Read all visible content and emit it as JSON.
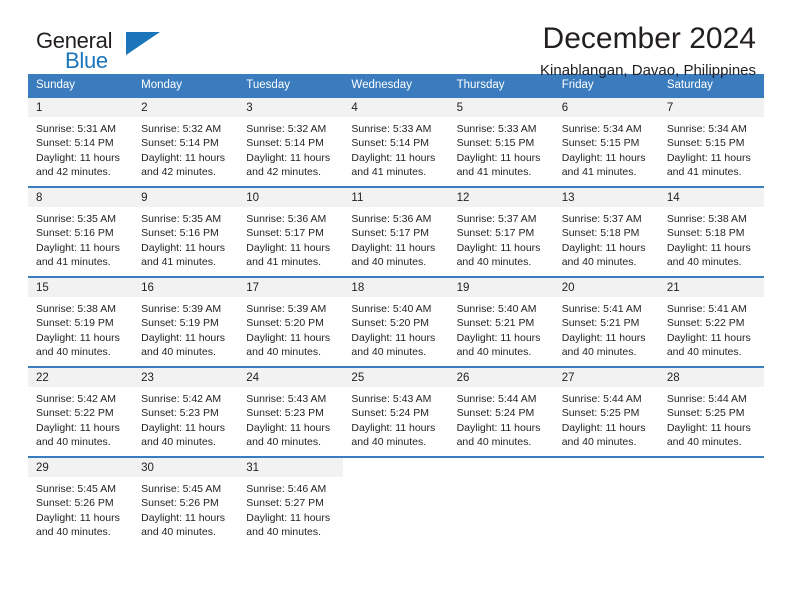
{
  "brand": {
    "name_part1": "General",
    "name_part2": "Blue",
    "triangle_color": "#1b75bb",
    "blue_color": "#1b75bb"
  },
  "header": {
    "title": "December 2024",
    "subtitle": "Kinablangan, Davao, Philippines"
  },
  "theme": {
    "header_bg": "#3a7cbe",
    "daynum_bg": "#f2f2f2",
    "text": "#231f20"
  },
  "weekday_headers": [
    "Sunday",
    "Monday",
    "Tuesday",
    "Wednesday",
    "Thursday",
    "Friday",
    "Saturday"
  ],
  "weeks": [
    [
      {
        "day": "1",
        "sunrise": "Sunrise: 5:31 AM",
        "sunset": "Sunset: 5:14 PM",
        "daylight1": "Daylight: 11 hours",
        "daylight2": "and 42 minutes."
      },
      {
        "day": "2",
        "sunrise": "Sunrise: 5:32 AM",
        "sunset": "Sunset: 5:14 PM",
        "daylight1": "Daylight: 11 hours",
        "daylight2": "and 42 minutes."
      },
      {
        "day": "3",
        "sunrise": "Sunrise: 5:32 AM",
        "sunset": "Sunset: 5:14 PM",
        "daylight1": "Daylight: 11 hours",
        "daylight2": "and 42 minutes."
      },
      {
        "day": "4",
        "sunrise": "Sunrise: 5:33 AM",
        "sunset": "Sunset: 5:14 PM",
        "daylight1": "Daylight: 11 hours",
        "daylight2": "and 41 minutes."
      },
      {
        "day": "5",
        "sunrise": "Sunrise: 5:33 AM",
        "sunset": "Sunset: 5:15 PM",
        "daylight1": "Daylight: 11 hours",
        "daylight2": "and 41 minutes."
      },
      {
        "day": "6",
        "sunrise": "Sunrise: 5:34 AM",
        "sunset": "Sunset: 5:15 PM",
        "daylight1": "Daylight: 11 hours",
        "daylight2": "and 41 minutes."
      },
      {
        "day": "7",
        "sunrise": "Sunrise: 5:34 AM",
        "sunset": "Sunset: 5:15 PM",
        "daylight1": "Daylight: 11 hours",
        "daylight2": "and 41 minutes."
      }
    ],
    [
      {
        "day": "8",
        "sunrise": "Sunrise: 5:35 AM",
        "sunset": "Sunset: 5:16 PM",
        "daylight1": "Daylight: 11 hours",
        "daylight2": "and 41 minutes."
      },
      {
        "day": "9",
        "sunrise": "Sunrise: 5:35 AM",
        "sunset": "Sunset: 5:16 PM",
        "daylight1": "Daylight: 11 hours",
        "daylight2": "and 41 minutes."
      },
      {
        "day": "10",
        "sunrise": "Sunrise: 5:36 AM",
        "sunset": "Sunset: 5:17 PM",
        "daylight1": "Daylight: 11 hours",
        "daylight2": "and 41 minutes."
      },
      {
        "day": "11",
        "sunrise": "Sunrise: 5:36 AM",
        "sunset": "Sunset: 5:17 PM",
        "daylight1": "Daylight: 11 hours",
        "daylight2": "and 40 minutes."
      },
      {
        "day": "12",
        "sunrise": "Sunrise: 5:37 AM",
        "sunset": "Sunset: 5:17 PM",
        "daylight1": "Daylight: 11 hours",
        "daylight2": "and 40 minutes."
      },
      {
        "day": "13",
        "sunrise": "Sunrise: 5:37 AM",
        "sunset": "Sunset: 5:18 PM",
        "daylight1": "Daylight: 11 hours",
        "daylight2": "and 40 minutes."
      },
      {
        "day": "14",
        "sunrise": "Sunrise: 5:38 AM",
        "sunset": "Sunset: 5:18 PM",
        "daylight1": "Daylight: 11 hours",
        "daylight2": "and 40 minutes."
      }
    ],
    [
      {
        "day": "15",
        "sunrise": "Sunrise: 5:38 AM",
        "sunset": "Sunset: 5:19 PM",
        "daylight1": "Daylight: 11 hours",
        "daylight2": "and 40 minutes."
      },
      {
        "day": "16",
        "sunrise": "Sunrise: 5:39 AM",
        "sunset": "Sunset: 5:19 PM",
        "daylight1": "Daylight: 11 hours",
        "daylight2": "and 40 minutes."
      },
      {
        "day": "17",
        "sunrise": "Sunrise: 5:39 AM",
        "sunset": "Sunset: 5:20 PM",
        "daylight1": "Daylight: 11 hours",
        "daylight2": "and 40 minutes."
      },
      {
        "day": "18",
        "sunrise": "Sunrise: 5:40 AM",
        "sunset": "Sunset: 5:20 PM",
        "daylight1": "Daylight: 11 hours",
        "daylight2": "and 40 minutes."
      },
      {
        "day": "19",
        "sunrise": "Sunrise: 5:40 AM",
        "sunset": "Sunset: 5:21 PM",
        "daylight1": "Daylight: 11 hours",
        "daylight2": "and 40 minutes."
      },
      {
        "day": "20",
        "sunrise": "Sunrise: 5:41 AM",
        "sunset": "Sunset: 5:21 PM",
        "daylight1": "Daylight: 11 hours",
        "daylight2": "and 40 minutes."
      },
      {
        "day": "21",
        "sunrise": "Sunrise: 5:41 AM",
        "sunset": "Sunset: 5:22 PM",
        "daylight1": "Daylight: 11 hours",
        "daylight2": "and 40 minutes."
      }
    ],
    [
      {
        "day": "22",
        "sunrise": "Sunrise: 5:42 AM",
        "sunset": "Sunset: 5:22 PM",
        "daylight1": "Daylight: 11 hours",
        "daylight2": "and 40 minutes."
      },
      {
        "day": "23",
        "sunrise": "Sunrise: 5:42 AM",
        "sunset": "Sunset: 5:23 PM",
        "daylight1": "Daylight: 11 hours",
        "daylight2": "and 40 minutes."
      },
      {
        "day": "24",
        "sunrise": "Sunrise: 5:43 AM",
        "sunset": "Sunset: 5:23 PM",
        "daylight1": "Daylight: 11 hours",
        "daylight2": "and 40 minutes."
      },
      {
        "day": "25",
        "sunrise": "Sunrise: 5:43 AM",
        "sunset": "Sunset: 5:24 PM",
        "daylight1": "Daylight: 11 hours",
        "daylight2": "and 40 minutes."
      },
      {
        "day": "26",
        "sunrise": "Sunrise: 5:44 AM",
        "sunset": "Sunset: 5:24 PM",
        "daylight1": "Daylight: 11 hours",
        "daylight2": "and 40 minutes."
      },
      {
        "day": "27",
        "sunrise": "Sunrise: 5:44 AM",
        "sunset": "Sunset: 5:25 PM",
        "daylight1": "Daylight: 11 hours",
        "daylight2": "and 40 minutes."
      },
      {
        "day": "28",
        "sunrise": "Sunrise: 5:44 AM",
        "sunset": "Sunset: 5:25 PM",
        "daylight1": "Daylight: 11 hours",
        "daylight2": "and 40 minutes."
      }
    ],
    [
      {
        "day": "29",
        "sunrise": "Sunrise: 5:45 AM",
        "sunset": "Sunset: 5:26 PM",
        "daylight1": "Daylight: 11 hours",
        "daylight2": "and 40 minutes."
      },
      {
        "day": "30",
        "sunrise": "Sunrise: 5:45 AM",
        "sunset": "Sunset: 5:26 PM",
        "daylight1": "Daylight: 11 hours",
        "daylight2": "and 40 minutes."
      },
      {
        "day": "31",
        "sunrise": "Sunrise: 5:46 AM",
        "sunset": "Sunset: 5:27 PM",
        "daylight1": "Daylight: 11 hours",
        "daylight2": "and 40 minutes."
      },
      null,
      null,
      null,
      null
    ]
  ]
}
